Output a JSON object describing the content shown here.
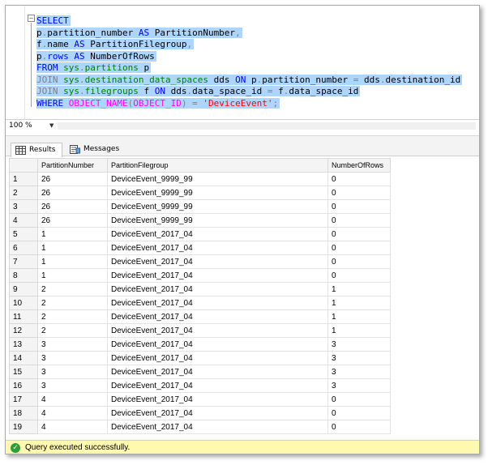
{
  "editor": {
    "lines": [
      [
        {
          "t": "SELECT",
          "c": "kw"
        }
      ],
      [
        {
          "t": "p",
          "c": ""
        },
        {
          "t": ".",
          "c": "gray"
        },
        {
          "t": "partition_number ",
          "c": ""
        },
        {
          "t": "AS",
          "c": "kw"
        },
        {
          "t": " PartitionNumber",
          "c": ""
        },
        {
          "t": ",",
          "c": "gray"
        }
      ],
      [
        {
          "t": "f",
          "c": ""
        },
        {
          "t": ".",
          "c": "gray"
        },
        {
          "t": "name ",
          "c": ""
        },
        {
          "t": "AS",
          "c": "kw"
        },
        {
          "t": " PartitionFilegroup",
          "c": ""
        },
        {
          "t": ",",
          "c": "gray"
        }
      ],
      [
        {
          "t": "p",
          "c": ""
        },
        {
          "t": ".",
          "c": "gray"
        },
        {
          "t": "rows ",
          "c": "kw"
        },
        {
          "t": "AS",
          "c": "kw"
        },
        {
          "t": " NumberOfRows",
          "c": ""
        }
      ],
      [
        {
          "t": "FROM ",
          "c": "kw"
        },
        {
          "t": "sys",
          "c": "sys"
        },
        {
          "t": ".",
          "c": "gray"
        },
        {
          "t": "partitions",
          "c": "sys"
        },
        {
          "t": " p",
          "c": ""
        }
      ],
      [
        {
          "t": "JOIN ",
          "c": "gray"
        },
        {
          "t": "sys",
          "c": "sys"
        },
        {
          "t": ".",
          "c": "gray"
        },
        {
          "t": "destination_data_spaces",
          "c": "sys"
        },
        {
          "t": " dds ",
          "c": ""
        },
        {
          "t": "ON",
          "c": "kw"
        },
        {
          "t": " p",
          "c": ""
        },
        {
          "t": ".",
          "c": "gray"
        },
        {
          "t": "partition_number ",
          "c": ""
        },
        {
          "t": "=",
          "c": "gray"
        },
        {
          "t": " dds",
          "c": ""
        },
        {
          "t": ".",
          "c": "gray"
        },
        {
          "t": "destination_id",
          "c": ""
        }
      ],
      [
        {
          "t": "JOIN ",
          "c": "gray"
        },
        {
          "t": "sys",
          "c": "sys"
        },
        {
          "t": ".",
          "c": "gray"
        },
        {
          "t": "filegroups",
          "c": "sys"
        },
        {
          "t": " f ",
          "c": ""
        },
        {
          "t": "ON",
          "c": "kw"
        },
        {
          "t": " dds",
          "c": ""
        },
        {
          "t": ".",
          "c": "gray"
        },
        {
          "t": "data_space_id ",
          "c": ""
        },
        {
          "t": "=",
          "c": "gray"
        },
        {
          "t": " f",
          "c": ""
        },
        {
          "t": ".",
          "c": "gray"
        },
        {
          "t": "data_space_id",
          "c": ""
        }
      ],
      [
        {
          "t": "WHERE ",
          "c": "kw"
        },
        {
          "t": "OBJECT_NAME",
          "c": "fn"
        },
        {
          "t": "(",
          "c": "gray"
        },
        {
          "t": "OBJECT_ID",
          "c": "fn"
        },
        {
          "t": ")",
          "c": "gray"
        },
        {
          "t": " ",
          "c": ""
        },
        {
          "t": "=",
          "c": "gray"
        },
        {
          "t": " ",
          "c": ""
        },
        {
          "t": "'DeviceEvent'",
          "c": "str"
        },
        {
          "t": ";",
          "c": "gray"
        }
      ]
    ]
  },
  "zoom": {
    "value": "100 %"
  },
  "tabs": {
    "results": "Results",
    "messages": "Messages"
  },
  "grid": {
    "columns": [
      "PartitionNumber",
      "PartitionFilegroup",
      "NumberOfRows"
    ],
    "rows": [
      [
        "1",
        "26",
        "DeviceEvent_9999_99",
        "0"
      ],
      [
        "2",
        "26",
        "DeviceEvent_9999_99",
        "0"
      ],
      [
        "3",
        "26",
        "DeviceEvent_9999_99",
        "0"
      ],
      [
        "4",
        "26",
        "DeviceEvent_9999_99",
        "0"
      ],
      [
        "5",
        "1",
        "DeviceEvent_2017_04",
        "0"
      ],
      [
        "6",
        "1",
        "DeviceEvent_2017_04",
        "0"
      ],
      [
        "7",
        "1",
        "DeviceEvent_2017_04",
        "0"
      ],
      [
        "8",
        "1",
        "DeviceEvent_2017_04",
        "0"
      ],
      [
        "9",
        "2",
        "DeviceEvent_2017_04",
        "1"
      ],
      [
        "10",
        "2",
        "DeviceEvent_2017_04",
        "1"
      ],
      [
        "11",
        "2",
        "DeviceEvent_2017_04",
        "1"
      ],
      [
        "12",
        "2",
        "DeviceEvent_2017_04",
        "1"
      ],
      [
        "13",
        "3",
        "DeviceEvent_2017_04",
        "3"
      ],
      [
        "14",
        "3",
        "DeviceEvent_2017_04",
        "3"
      ],
      [
        "15",
        "3",
        "DeviceEvent_2017_04",
        "3"
      ],
      [
        "16",
        "3",
        "DeviceEvent_2017_04",
        "3"
      ],
      [
        "17",
        "4",
        "DeviceEvent_2017_04",
        "0"
      ],
      [
        "18",
        "4",
        "DeviceEvent_2017_04",
        "0"
      ],
      [
        "19",
        "4",
        "DeviceEvent_2017_04",
        "0"
      ]
    ]
  },
  "status": {
    "text": "Query executed successfully.",
    "icon": "check-circle-icon",
    "color": "#2e9e3a"
  }
}
